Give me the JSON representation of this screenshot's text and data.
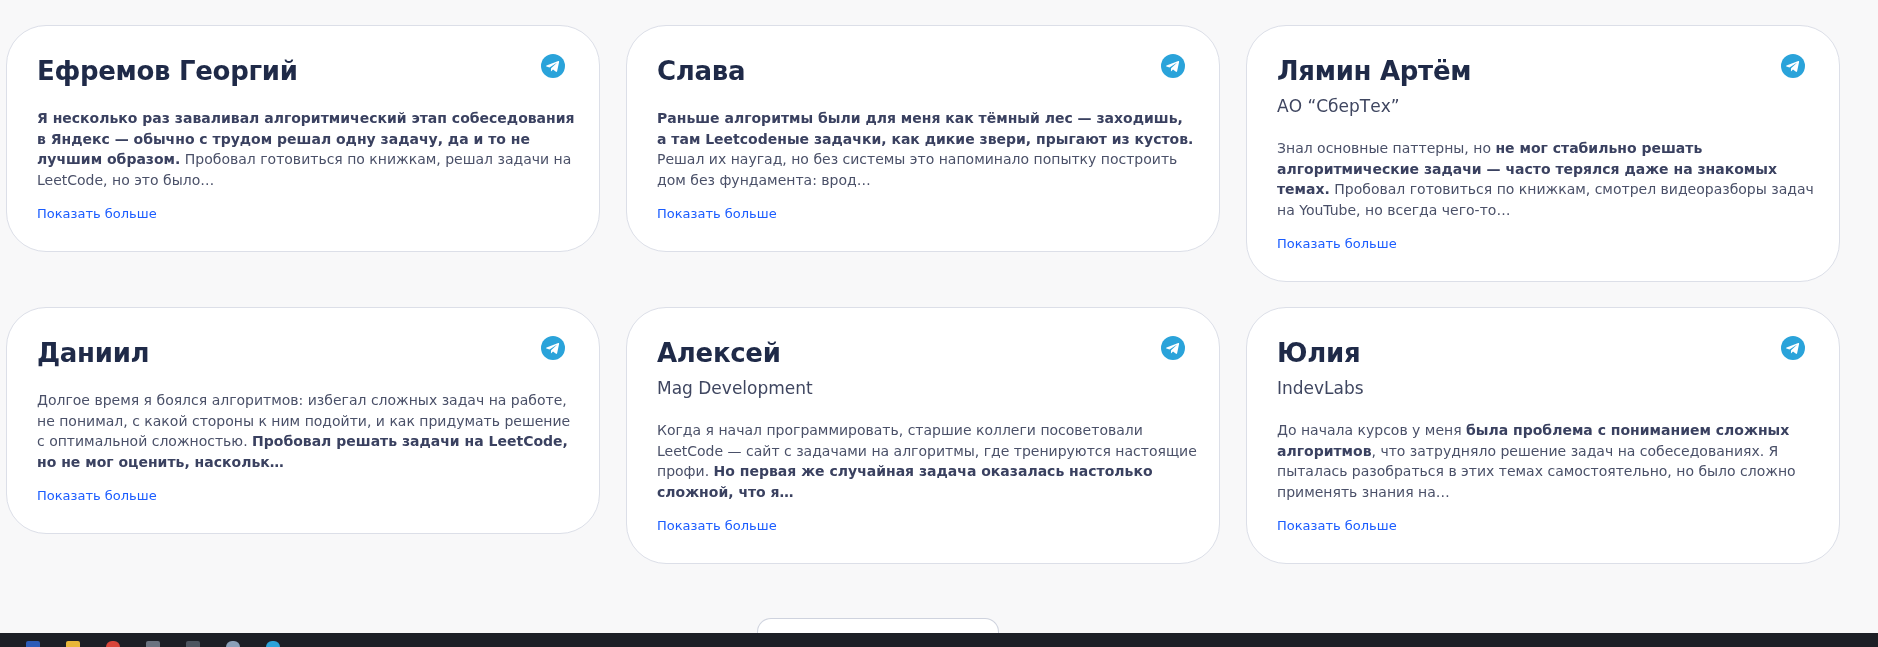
{
  "testimonials": [
    {
      "name": "Ефремов Георгий",
      "text": "**Я несколько раз заваливал алгоритмический этап собеседования в Яндекс — обычно с трудом решал одну задачу, да и то не лучшим образом.** Пробовал готовиться по книжкам, решал задачи на LeetCode, но это было…",
      "link": "Показать больше"
    },
    {
      "name": "Слава",
      "text": "**Раньше алгоритмы были для меня как тёмный лес — заходишь, а там Leetcodeные задачки, как дикие звери, прыгают из кустов.** Решал их наугад, но без системы это напоминало попытку построить дом без фундамента: врод…",
      "link": "Показать больше"
    },
    {
      "name": "Лямин Артём",
      "company": "АО “СберТех”",
      "text": "Знал основные паттерны, но **не мог стабильно решать алгоритмические задачи — часто терялся даже на знакомых темах.** Пробовал готовиться по книжкам, смотрел видеоразборы задач на YouTube, но всегда чего-то…",
      "link": "Показать больше"
    },
    {
      "name": "Даниил",
      "text": "Долгое время я боялся алгоритмов: избегал сложных задач на работе, не понимал, с какой стороны к ним подойти, и как придумать решение с оптимальной сложностью. **Пробовал решать задачи на LeetCode, но не мог оценить, наскольк…**",
      "link": "Показать больше"
    },
    {
      "name": "Алексей",
      "company": "Mag Development",
      "text": "Когда я начал программировать, старшие коллеги посоветовали LeetCode — сайт с задачами на алгоритмы, где тренируются настоящие профи. **Но первая же случайная задача оказалась настолько сложной, что я…**",
      "link": "Показать больше"
    },
    {
      "name": "Юлия",
      "company": "IndevLabs",
      "text": "До начала курсов у меня **была проблема с пониманием сложных алгоритмов**, что затрудняло решение задач на собеседованиях. Я пыталась разобраться в этих темах самостоятельно, но было сложно применять знания на…",
      "link": "Показать больше"
    }
  ]
}
